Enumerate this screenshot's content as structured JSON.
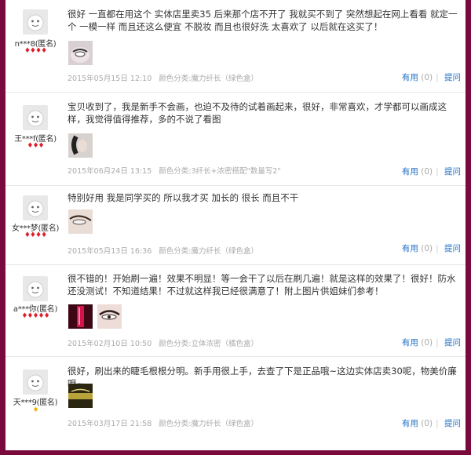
{
  "reviews": [
    {
      "nick": "n***8(匿名)",
      "level_icons": "♦♦♦♦",
      "level_color": "red",
      "content": "很好 一直都在用这个 实体店里卖35 后来那个店不开了 我就买不到了 突然想起在网上看看 就定一个 一模一样 而且还这么便宜 不脱妆 而且也很好洗 太喜欢了 以后就在这买了！",
      "photo_count": 1,
      "date": "2015年05月15日 12:10",
      "sku": "颜色分类:魔力纤长（绿色盒）",
      "helpful_label": "有用",
      "helpful_count": "(0)",
      "ask_label": "提问"
    },
    {
      "nick": "王***f(匿名)",
      "level_icons": "♦♦♦",
      "level_color": "red",
      "content": "宝贝收到了，我是新手不会画，也迫不及待的试着画起来，很好，非常喜欢，才学都可以画成这样，我觉得值得推荐，多的不说了看图",
      "photo_count": 1,
      "date": "2015年06月24日 13:15",
      "sku": "颜色分类:3纤长+浓密搭配\"数量写2\"",
      "helpful_label": "有用",
      "helpful_count": "(0)",
      "ask_label": "提问"
    },
    {
      "nick": "女***梦(匿名)",
      "level_icons": "♦♦♦♦",
      "level_color": "red",
      "content": "特别好用 我是同学买的 所以我才买 加长的 很长 而且不干",
      "photo_count": 1,
      "date": "2015年05月13日 16:36",
      "sku": "颜色分类:魔力纤长（绿色盒）",
      "helpful_label": "有用",
      "helpful_count": "(0)",
      "ask_label": "提问"
    },
    {
      "nick": "a***你(匿名)",
      "level_icons": "♦♦♦♦♦",
      "level_color": "red",
      "content": "很不错的！开始刷一遍！效果不明显！等一会干了以后在刷几遍！就是这样的效果了！很好！防水还没测试！不知道结果！不过就这样我已经很满意了！附上图片供姐妹们参考！",
      "photo_count": 2,
      "date": "2015年02月10日 10:50",
      "sku": "颜色分类:立体浓密（橘色盒）",
      "helpful_label": "有用",
      "helpful_count": "(0)",
      "ask_label": "提问"
    },
    {
      "nick": "天***9(匿名)",
      "level_icons": "♦",
      "level_color": "gold",
      "content": "很好，刷出来的睫毛根根分明。新手用很上手，去查了下是正品哦~这边实体店卖30呢，物美价廉哦~",
      "photo_count": 1,
      "date": "2015年03月17日 21:58",
      "sku": "颜色分类:魔力纤长（绿色盒）",
      "helpful_label": "有用",
      "helpful_count": "(0)",
      "ask_label": "提问"
    }
  ]
}
